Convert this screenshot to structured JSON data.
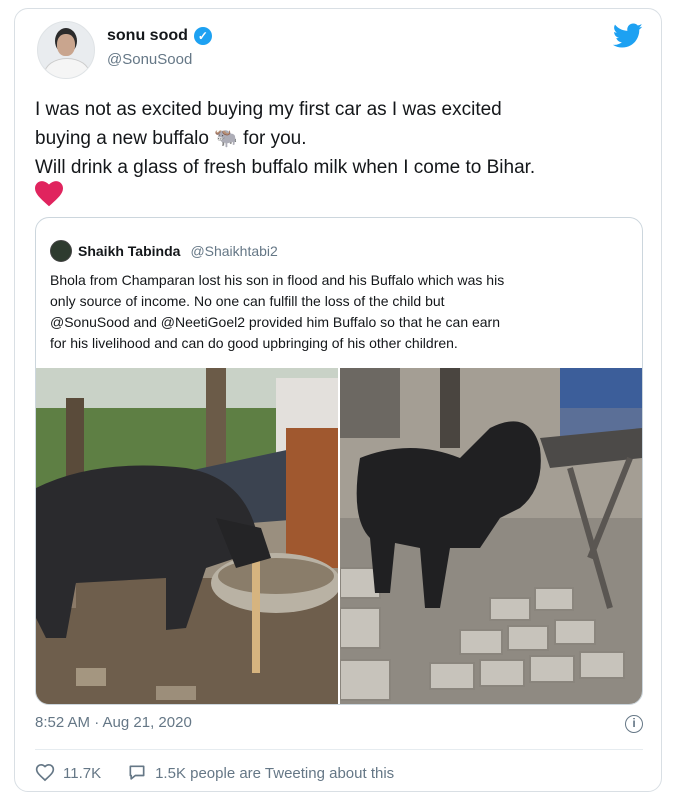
{
  "author": {
    "display_name": "sonu sood",
    "handle": "@SonuSood",
    "verified_icon": "verified-badge-icon",
    "brand_icon": "twitter-bird-icon"
  },
  "tweet": {
    "lines": [
      "I was not as excited buying my first car as I was excited",
      "buying a new buffalo 🐃 for you.",
      "Will drink a glass of fresh buffalo milk when I come to Bihar."
    ],
    "emoji_heart": "red-heart-icon"
  },
  "quoted_tweet": {
    "display_name": "Shaikh Tabinda",
    "handle": "@Shaikhtabi2",
    "lines": [
      "Bhola from Champaran lost his son in flood and his Buffalo which was his",
      "only source of income. No one can fulfill the loss of the child but",
      "@SonuSood and @NeetiGoel2 provided him Buffalo so that he can earn",
      "for his livelihood and can do good upbringing of his other children."
    ],
    "photos": [
      "buffalo-eating-photo",
      "buffalo-calf-photo"
    ]
  },
  "meta": {
    "timestamp": "8:52 AM · Aug 21, 2020",
    "info_icon": "info-icon"
  },
  "actions": {
    "likes": "11.7K",
    "retweet_text": "1.5K people are Tweeting about this"
  },
  "colors": {
    "accent": "#1da1f2",
    "heart": "#e0245e",
    "muted": "#657786",
    "border": "#ccd6dd"
  }
}
